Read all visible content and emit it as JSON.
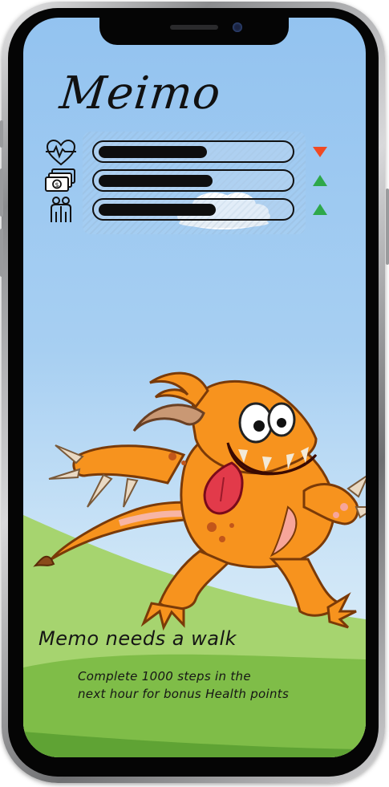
{
  "app": {
    "pet_name": "Meimo"
  },
  "stats": [
    {
      "id": "health",
      "icon": "heart-pulse-icon",
      "level": 0.57,
      "trend": "down",
      "trend_color": "#f04a23"
    },
    {
      "id": "money",
      "icon": "money-icon",
      "level": 0.6,
      "trend": "up",
      "trend_color": "#2ea84a"
    },
    {
      "id": "social",
      "icon": "people-icon",
      "level": 0.62,
      "trend": "up",
      "trend_color": "#2ea84a"
    }
  ],
  "task": {
    "title": "Memo needs a walk",
    "line1": "Complete 1000 steps in the",
    "line2": "next hour for bonus Health points"
  },
  "colors": {
    "sky": "#93c3f0",
    "grass_light": "#9ed26a",
    "grass_dark": "#6fb33f",
    "monster": "#f7931e"
  }
}
